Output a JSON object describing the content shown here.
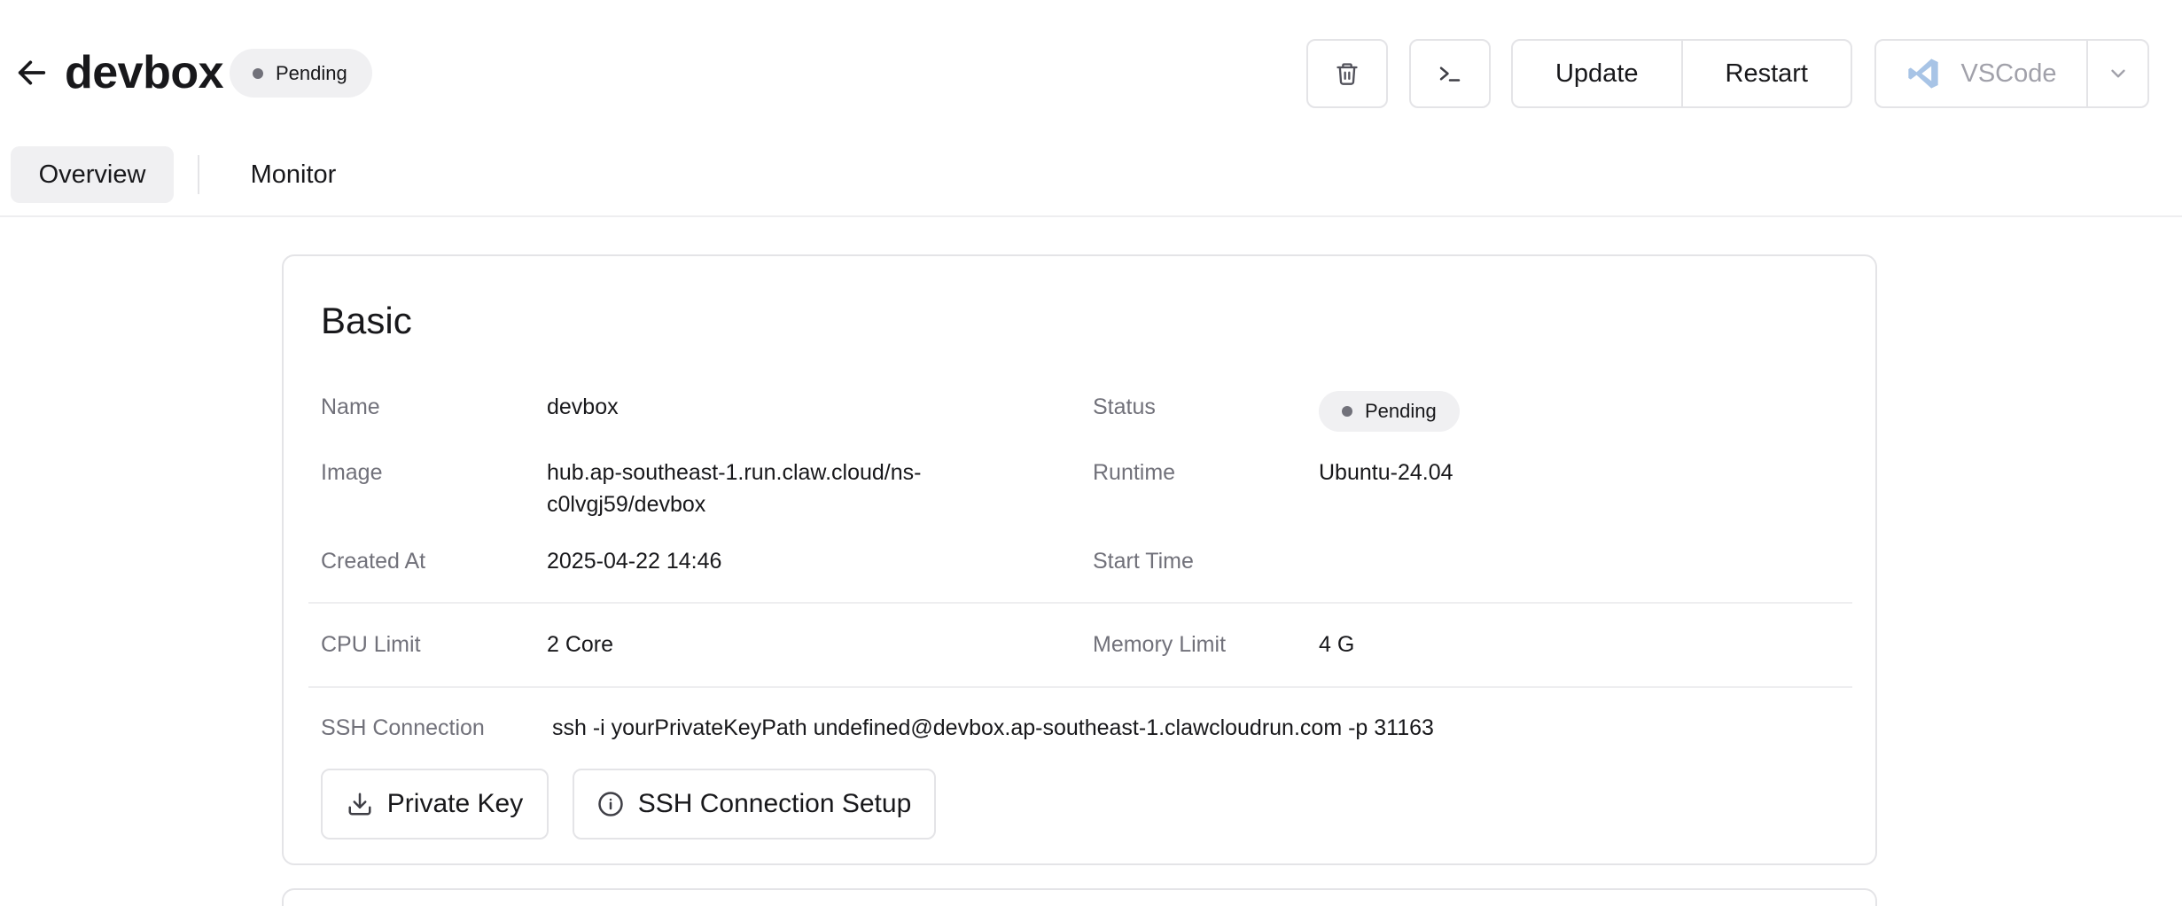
{
  "header": {
    "title": "devbox",
    "status": "Pending",
    "update_label": "Update",
    "restart_label": "Restart",
    "ide_label": "VSCode"
  },
  "tabs": [
    {
      "label": "Overview",
      "active": true
    },
    {
      "label": "Monitor",
      "active": false
    }
  ],
  "basic": {
    "title": "Basic",
    "name_label": "Name",
    "name_value": "devbox",
    "status_label": "Status",
    "status_value": "Pending",
    "image_label": "Image",
    "image_value_line1": "hub.ap-southeast-1.run.claw.cloud/ns-",
    "image_value_line2": "c0lvgj59/devbox",
    "runtime_label": "Runtime",
    "runtime_value": "Ubuntu-24.04",
    "created_label": "Created At",
    "created_value": "2025-04-22 14:46",
    "start_label": "Start Time",
    "start_value": "",
    "cpu_label": "CPU Limit",
    "cpu_value": "2 Core",
    "memory_label": "Memory Limit",
    "memory_value": "4 G",
    "ssh_label": "SSH Connection",
    "ssh_value": "ssh -i yourPrivateKeyPath undefined@devbox.ap-southeast-1.clawcloudrun.com -p 31163",
    "private_key_label": "Private Key",
    "ssh_setup_label": "SSH Connection Setup"
  },
  "colors": {
    "status_dot": "#71717a",
    "pill_bg": "#f0f0f2",
    "border": "#e4e4e7",
    "label_text": "#71717a"
  },
  "icons": [
    "back-arrow-icon",
    "trash-icon",
    "terminal-icon",
    "vscode-icon",
    "chevron-down-icon",
    "download-icon",
    "info-icon"
  ]
}
